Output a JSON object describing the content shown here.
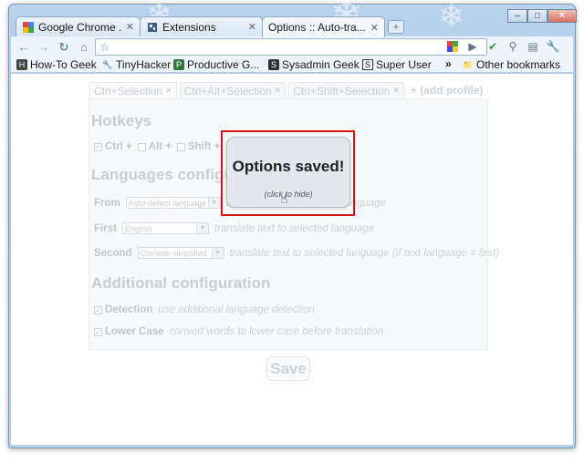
{
  "browser": {
    "tabs": [
      {
        "title": "Google Chrome ...",
        "icon": "google-icon"
      },
      {
        "title": "Extensions",
        "icon": "extensions-icon"
      },
      {
        "title": "Options :: Auto-tra...",
        "icon": "none"
      }
    ],
    "new_tab_label": "+",
    "window_buttons": {
      "minimize": "–",
      "maximize": "□",
      "close": "✕"
    },
    "bookmarks": [
      {
        "label": "How-To Geek",
        "icon": "htg-icon"
      },
      {
        "label": "TinyHacker",
        "icon": "tinyhacker-icon"
      },
      {
        "label": "Productive G...",
        "icon": "pg-icon"
      },
      {
        "label": "Sysadmin Geek",
        "icon": "sysadmin-icon"
      },
      {
        "label": "Super User",
        "icon": "superuser-icon"
      }
    ],
    "bookmarks_overflow": "»",
    "other_bookmarks": "Other bookmarks"
  },
  "options_page": {
    "profile_tabs": [
      "Ctrl+Selection",
      "Ctrl+Alt+Selection",
      "Ctrl+Shift+Selection"
    ],
    "add_profile": "+ (add profile)",
    "hotkeys_title": "Hotkeys",
    "hotkeys": {
      "ctrl": "Ctrl +",
      "alt": "Alt +",
      "shift": "Shift +"
    },
    "languages_title": "Languages configuration",
    "from": {
      "label": "From",
      "select": "Auto-detect language",
      "desc": "translate text to selected language"
    },
    "first": {
      "label": "First",
      "select": "English",
      "desc": "translate text to selected language"
    },
    "second": {
      "label": "Second",
      "select": "Chinese simplified",
      "desc": "translate text to selected language (if text language = first)"
    },
    "additional_title": "Additional configuration",
    "detection": {
      "label": "Detection",
      "desc": "use additional language detection"
    },
    "lowercase": {
      "label": "Lower Case",
      "desc": "convert words to lower case before translation"
    },
    "save_label": "Save"
  },
  "popup": {
    "message": "Options saved!",
    "hint": "(click to hide)"
  },
  "colors": {
    "highlight_border": "#d41414",
    "frame": "#b9d3ec"
  }
}
